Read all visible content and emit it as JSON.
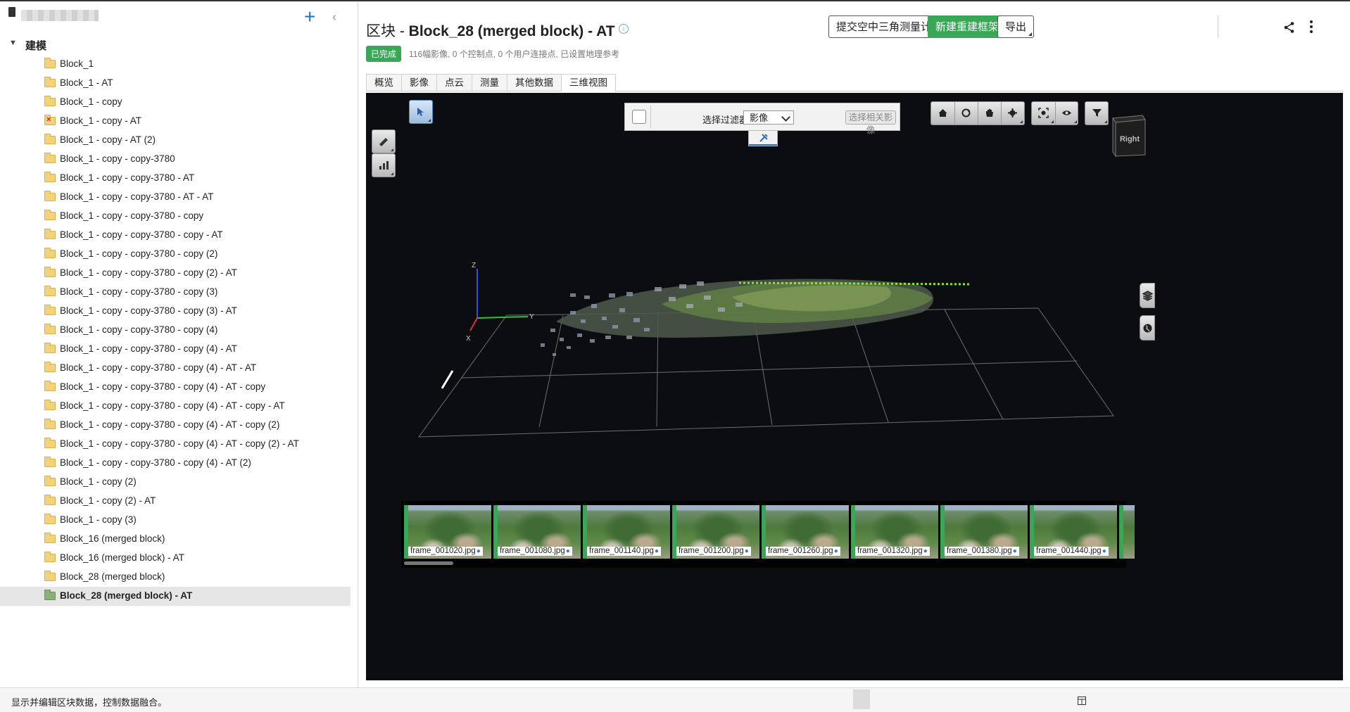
{
  "sidebar": {
    "root_label": "建模",
    "items": [
      {
        "label": "Block_1",
        "icon": "folder-icon"
      },
      {
        "label": "Block_1 - AT",
        "icon": "folder-icon"
      },
      {
        "label": "Block_1 - copy",
        "icon": "folder-icon"
      },
      {
        "label": "Block_1 - copy - AT",
        "icon": "folder-error-icon"
      },
      {
        "label": "Block_1 - copy - AT (2)",
        "icon": "folder-icon"
      },
      {
        "label": "Block_1 - copy - copy-3780",
        "icon": "folder-icon"
      },
      {
        "label": "Block_1 - copy - copy-3780 - AT",
        "icon": "folder-icon"
      },
      {
        "label": "Block_1 - copy - copy-3780 - AT - AT",
        "icon": "folder-icon"
      },
      {
        "label": "Block_1 - copy - copy-3780 - copy",
        "icon": "folder-icon"
      },
      {
        "label": "Block_1 - copy - copy-3780 - copy - AT",
        "icon": "folder-icon"
      },
      {
        "label": "Block_1 - copy - copy-3780 - copy (2)",
        "icon": "folder-icon"
      },
      {
        "label": "Block_1 - copy - copy-3780 - copy (2) - AT",
        "icon": "folder-icon"
      },
      {
        "label": "Block_1 - copy - copy-3780 - copy (3)",
        "icon": "folder-icon"
      },
      {
        "label": "Block_1 - copy - copy-3780 - copy (3) - AT",
        "icon": "folder-icon"
      },
      {
        "label": "Block_1 - copy - copy-3780 - copy (4)",
        "icon": "folder-icon"
      },
      {
        "label": "Block_1 - copy - copy-3780 - copy (4) - AT",
        "icon": "folder-icon"
      },
      {
        "label": "Block_1 - copy - copy-3780 - copy (4) - AT - AT",
        "icon": "folder-icon"
      },
      {
        "label": "Block_1 - copy - copy-3780 - copy (4) - AT - copy",
        "icon": "folder-icon"
      },
      {
        "label": "Block_1 - copy - copy-3780 - copy (4) - AT - copy - AT",
        "icon": "folder-icon"
      },
      {
        "label": "Block_1 - copy - copy-3780 - copy (4) - AT - copy (2)",
        "icon": "folder-icon"
      },
      {
        "label": "Block_1 - copy - copy-3780 - copy (4) - AT - copy (2) - AT",
        "icon": "folder-icon"
      },
      {
        "label": "Block_1 - copy - copy-3780 - copy (4) - AT (2)",
        "icon": "folder-icon"
      },
      {
        "label": "Block_1 - copy (2)",
        "icon": "folder-icon"
      },
      {
        "label": "Block_1 - copy (2) - AT",
        "icon": "folder-icon"
      },
      {
        "label": "Block_1 - copy (3)",
        "icon": "folder-icon"
      },
      {
        "label": "Block_16 (merged block)",
        "icon": "folder-icon"
      },
      {
        "label": "Block_16 (merged block) - AT",
        "icon": "folder-icon"
      },
      {
        "label": "Block_28 (merged block)",
        "icon": "folder-icon"
      },
      {
        "label": "Block_28 (merged block) - AT",
        "icon": "folder-done-icon",
        "selected": true
      }
    ]
  },
  "header": {
    "title_prefix": "区块 - ",
    "title": "Block_28 (merged block) - AT",
    "status_badge": "已完成",
    "summary": "116幅影像, 0 个控制点, 0 个用户连接点, 已设置地理参考",
    "buttons": {
      "submit_at": "提交空中三角测量计算",
      "new_reconstruction": "新建重建框架",
      "export": "导出"
    }
  },
  "tabs": [
    "概览",
    "影像",
    "点云",
    "测量",
    "其他数据",
    "三维视图"
  ],
  "active_tab": "三维视图",
  "viewer": {
    "filter_label": "选择过滤器:",
    "filter_value": "影像",
    "select_related_button": "选择相关影像",
    "viewcube_label": "Right",
    "axis_labels": {
      "x": "X",
      "y": "Y",
      "z": "Z"
    },
    "thumbnails": [
      "frame_001020.jpg",
      "frame_001080.jpg",
      "frame_001140.jpg",
      "frame_001200.jpg",
      "frame_001260.jpg",
      "frame_001320.jpg",
      "frame_001380.jpg",
      "frame_001440.jpg"
    ]
  },
  "statusbar": {
    "message": "显示并编辑区块数据，控制数据融合。"
  },
  "colors": {
    "accent": "#1a73c8",
    "success": "#3aa757",
    "viewer_bg": "#0c0d10"
  }
}
